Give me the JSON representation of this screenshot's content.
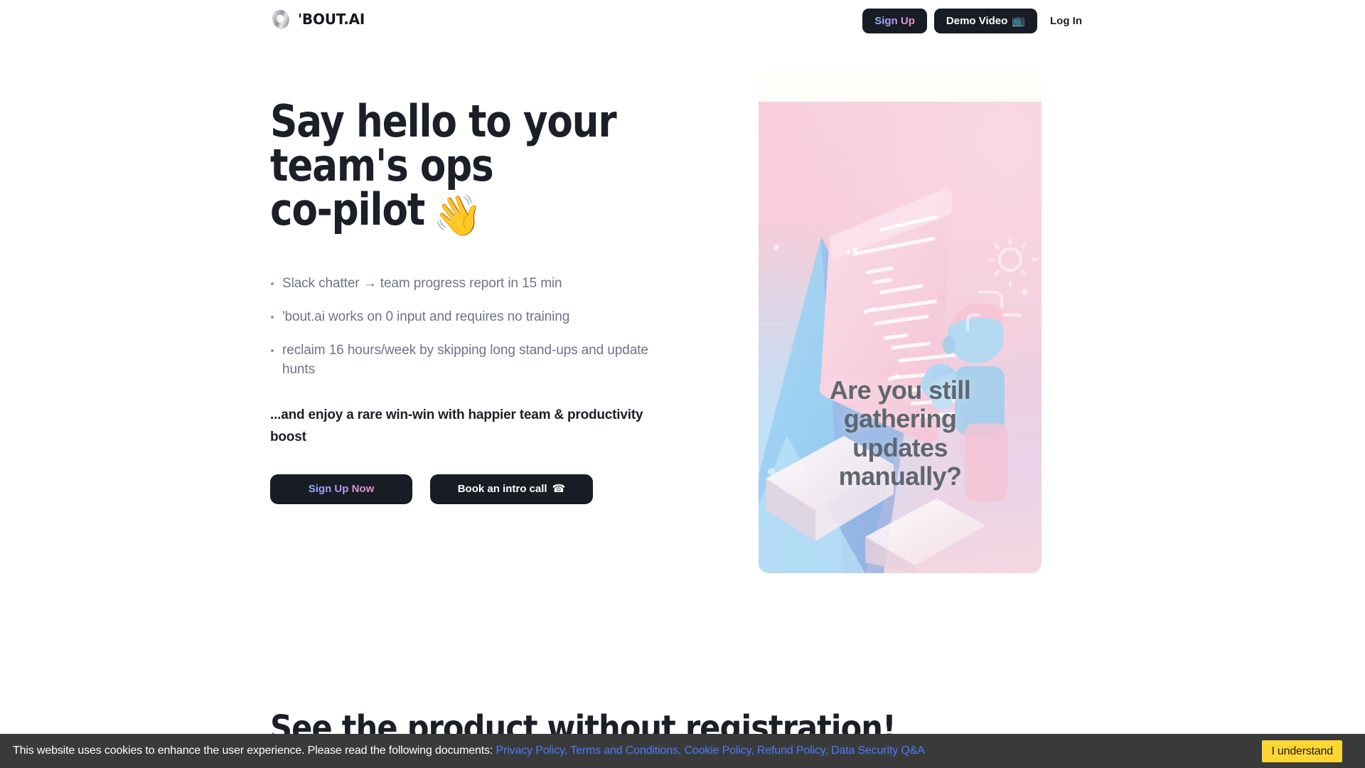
{
  "brand": {
    "name": "'BOUT.AI",
    "logo_icon": "chrome-ring-logo-icon"
  },
  "nav": {
    "sign_up_label": "Sign Up",
    "demo_video_label": "Demo Video",
    "demo_video_icon": "📺",
    "log_in_label": "Log In"
  },
  "hero": {
    "headline_line1": "Say hello to your",
    "headline_line2": "team's ops",
    "headline_line3": "co-pilot",
    "headline_emoji": "👋",
    "bullets": [
      "Slack chatter → team progress report in 15 min",
      "'bout.ai works on 0 input and requires no training",
      "reclaim 16 hours/week by skipping long stand-ups and update hunts"
    ],
    "tagline": "...and enjoy a rare win-win with happier team & productivity boost",
    "cta_primary_label": "Sign Up Now",
    "cta_secondary_label": "Book an intro call",
    "cta_secondary_icon": "☎",
    "art_overlay_line1": "Are you still",
    "art_overlay_line2": "gathering",
    "art_overlay_line3": "updates",
    "art_overlay_line4": "manually?",
    "art_alt": "3d-illustration-person-holding-long-receipt"
  },
  "next_section": {
    "heading": "See the product without registration!"
  },
  "cookie_banner": {
    "message": "This website uses cookies to enhance the user experience. Please read the following documents:",
    "links": [
      "Privacy Policy",
      "Terms and Conditions",
      "Cookie Policy",
      "Refund Policy",
      "Data Security Q&A"
    ],
    "accept_label": "I understand"
  },
  "colors": {
    "accent_dark": "#181c24",
    "gradient_start": "#93b4ff",
    "gradient_end": "#f592c7",
    "cookie_bg": "#3a3a3a",
    "cookie_link": "#4a7dfc",
    "cookie_button": "#ffd633",
    "muted_text": "#6c748a"
  }
}
